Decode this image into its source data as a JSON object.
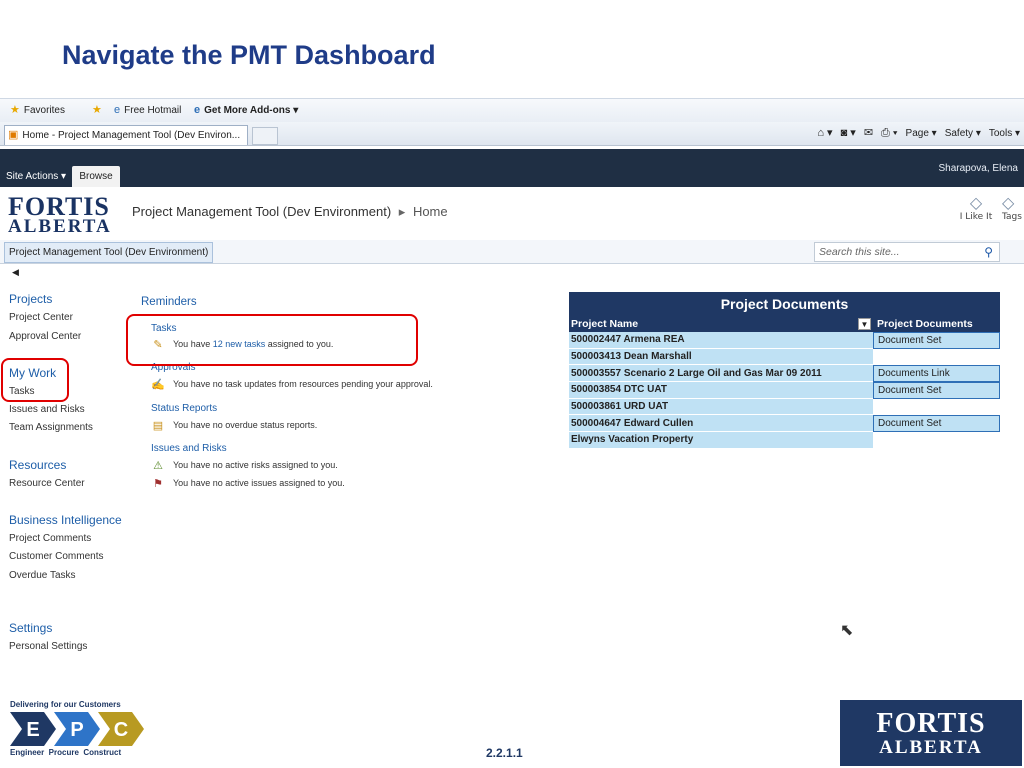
{
  "slide": {
    "title": "Navigate the PMT Dashboard",
    "page_number": "2.2.1.1"
  },
  "browser": {
    "favorites_label": "Favorites",
    "free_hotmail": "Free Hotmail",
    "get_addons": "Get More Add-ons ▾",
    "tab_title": "Home - Project Management Tool (Dev Environ...",
    "tools": {
      "page": "Page ▾",
      "safety": "Safety ▾",
      "tools": "Tools ▾"
    }
  },
  "sharepoint": {
    "site_actions": "Site Actions ▾",
    "browse_tab": "Browse",
    "user_name": "Sharapova, Elena",
    "logo_line1": "FORTIS",
    "logo_line2": "ALBERTA",
    "breadcrumb_site": "Project Management Tool (Dev Environment)",
    "breadcrumb_sep": "▸",
    "breadcrumb_page": "Home",
    "like_it": "I Like It",
    "tags_notes": "Tags & Notes",
    "topnav_tab": "Project Management Tool (Dev Environment)",
    "search_placeholder": "Search this site..."
  },
  "leftnav": {
    "projects": "Projects",
    "project_center": "Project Center",
    "approval_center": "Approval Center",
    "my_work": "My Work",
    "tasks": "Tasks",
    "issues_risks": "Issues and Risks",
    "team_assignments": "Team Assignments",
    "resources": "Resources",
    "resource_center": "Resource Center",
    "business_intelligence": "Business Intelligence",
    "project_comments": "Project Comments",
    "customer_comments": "Customer Comments",
    "overdue_tasks": "Overdue Tasks",
    "settings": "Settings",
    "personal_settings": "Personal Settings"
  },
  "reminders": {
    "heading": "Reminders",
    "tasks_heading": "Tasks",
    "tasks_prefix": "You have",
    "tasks_link": "12 new tasks",
    "tasks_suffix": "assigned to you.",
    "approvals_heading": "Approvals",
    "approvals_text": "You have no task updates from resources pending your approval.",
    "status_heading": "Status Reports",
    "status_text": "You have no overdue status reports.",
    "issues_heading": "Issues and Risks",
    "risks_text": "You have no active risks assigned to you.",
    "issues_text": "You have no active issues assigned to you."
  },
  "project_documents": {
    "title": "Project Documents",
    "col_name": "Project Name",
    "col_docs": "Project Documents",
    "rows": [
      {
        "name": "500002447 Armena REA",
        "doc": "Document Set"
      },
      {
        "name": "500003413 Dean Marshall",
        "doc": ""
      },
      {
        "name": "500003557 Scenario 2 Large Oil and Gas Mar 09 2011",
        "doc": "Documents Link"
      },
      {
        "name": "500003854 DTC UAT",
        "doc": "Document Set"
      },
      {
        "name": "500003861 URD UAT",
        "doc": ""
      },
      {
        "name": "500004647 Edward Cullen",
        "doc": "Document Set"
      },
      {
        "name": "Elwyns Vacation Property",
        "doc": ""
      }
    ]
  },
  "footer": {
    "epc_tagline": "Delivering for our Customers",
    "epc_letters": [
      "E",
      "P",
      "C"
    ],
    "epc_sub": "Engineer  Procure  Construct",
    "fortis_line1": "FORTIS",
    "fortis_line2": "ALBERTA"
  },
  "colors": {
    "title_blue": "#1f3c88",
    "ribbon_dark": "#1f2f44",
    "link_blue": "#1e5ea8",
    "table_header": "#1f3864",
    "table_cell": "#bfe1f4",
    "highlight_red": "#e00000"
  }
}
